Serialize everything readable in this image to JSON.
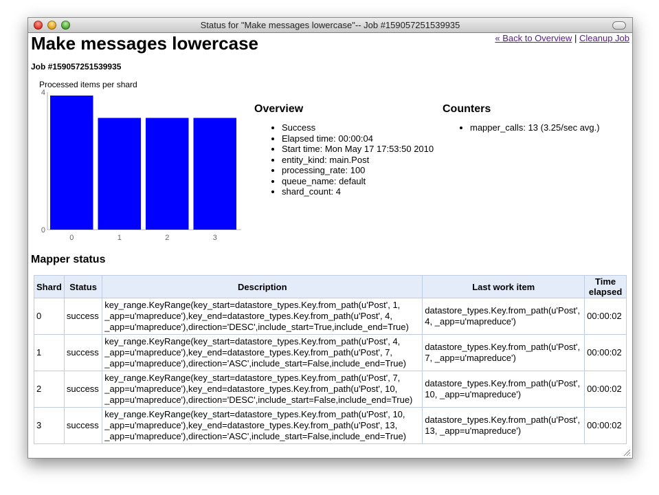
{
  "window": {
    "title": "Status for \"Make messages lowercase\"-- Job #159057251539935"
  },
  "links": {
    "back": "« Back to Overview",
    "separator": "|",
    "cleanup": "Cleanup Job"
  },
  "page": {
    "title": "Make messages lowercase",
    "job_id": "Job #159057251539935"
  },
  "chart_data": {
    "type": "bar",
    "title": "Processed items per shard",
    "categories": [
      "0",
      "1",
      "2",
      "3"
    ],
    "values": [
      3.9,
      3.25,
      3.25,
      3.25
    ],
    "ylim": [
      0,
      4
    ],
    "yticks": [
      "0",
      "4"
    ],
    "bar_color": "#0000ff",
    "grid": false
  },
  "overview": {
    "heading": "Overview",
    "items": [
      "Success",
      "Elapsed time: 00:00:04",
      "Start time: Mon May 17 17:53:50 2010",
      "entity_kind: main.Post",
      "processing_rate: 100",
      "queue_name: default",
      "shard_count: 4"
    ]
  },
  "counters": {
    "heading": "Counters",
    "items": [
      "mapper_calls: 13 (3.25/sec avg.)"
    ]
  },
  "mapper": {
    "heading": "Mapper status",
    "columns": [
      "Shard",
      "Status",
      "Description",
      "Last work item",
      "Time elapsed"
    ],
    "rows": [
      [
        "0",
        "success",
        "key_range.KeyRange(key_start=datastore_types.Key.from_path(u'Post', 1, _app=u'mapreduce'),key_end=datastore_types.Key.from_path(u'Post', 4, _app=u'mapreduce'),direction='DESC',include_start=True,include_end=True)",
        "datastore_types.Key.from_path(u'Post', 4, _app=u'mapreduce')",
        "00:00:02"
      ],
      [
        "1",
        "success",
        "key_range.KeyRange(key_start=datastore_types.Key.from_path(u'Post', 4, _app=u'mapreduce'),key_end=datastore_types.Key.from_path(u'Post', 7, _app=u'mapreduce'),direction='ASC',include_start=False,include_end=True)",
        "datastore_types.Key.from_path(u'Post', 7, _app=u'mapreduce')",
        "00:00:02"
      ],
      [
        "2",
        "success",
        "key_range.KeyRange(key_start=datastore_types.Key.from_path(u'Post', 7, _app=u'mapreduce'),key_end=datastore_types.Key.from_path(u'Post', 10, _app=u'mapreduce'),direction='DESC',include_start=False,include_end=True)",
        "datastore_types.Key.from_path(u'Post', 10, _app=u'mapreduce')",
        "00:00:02"
      ],
      [
        "3",
        "success",
        "key_range.KeyRange(key_start=datastore_types.Key.from_path(u'Post', 10, _app=u'mapreduce'),key_end=datastore_types.Key.from_path(u'Post', 13, _app=u'mapreduce'),direction='ASC',include_start=False,include_end=True)",
        "datastore_types.Key.from_path(u'Post', 13, _app=u'mapreduce')",
        "00:00:02"
      ]
    ]
  }
}
